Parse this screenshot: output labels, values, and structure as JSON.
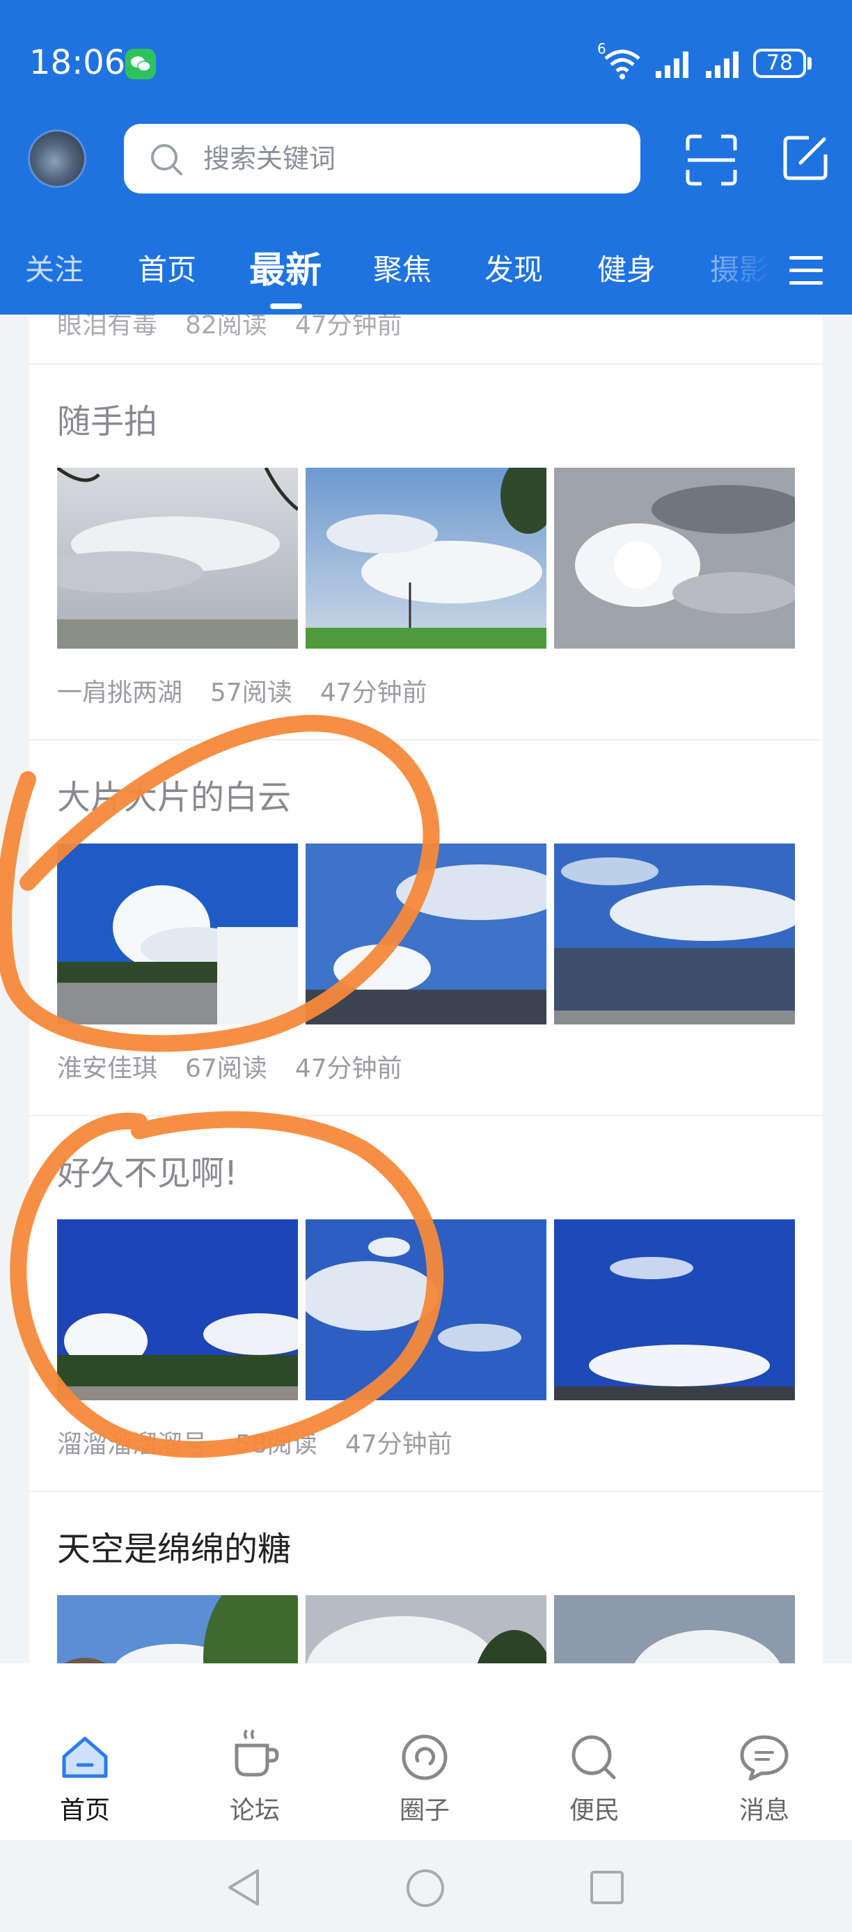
{
  "status_bar": {
    "time": "18:06",
    "battery": "78",
    "network": "6"
  },
  "search": {
    "placeholder": "搜索关键词"
  },
  "tabs": [
    "关注",
    "首页",
    "最新",
    "聚焦",
    "发现",
    "健身",
    "摄影"
  ],
  "active_tab": "最新",
  "feed": {
    "partial_top": {
      "author": "眼泪有毒",
      "reads": "82阅读",
      "time": "47分钟前"
    },
    "cards": [
      {
        "title": "随手拍",
        "author": "一肩挑两湖",
        "reads": "57阅读",
        "time": "47分钟前"
      },
      {
        "title": "大片大片的白云",
        "author": "淮安佳琪",
        "reads": "67阅读",
        "time": "47分钟前"
      },
      {
        "title": "好久不见啊!",
        "author": "溜溜溜溜溜号",
        "reads": "58阅读",
        "time": "47分钟前"
      },
      {
        "title": "天空是绵绵的糖"
      }
    ]
  },
  "bottom_nav": [
    {
      "label": "首页",
      "icon": "home-icon",
      "active": true
    },
    {
      "label": "论坛",
      "icon": "coffee-cup-icon",
      "active": false
    },
    {
      "label": "圈子",
      "icon": "circle-icon",
      "active": false
    },
    {
      "label": "便民",
      "icon": "magnifier-icon",
      "active": false
    },
    {
      "label": "消息",
      "icon": "chat-bubble-icon",
      "active": false
    }
  ],
  "colors": {
    "brand_blue": "#1f73e0",
    "annotation_orange": "#f5893a",
    "active_nav": "#2b7de9"
  }
}
